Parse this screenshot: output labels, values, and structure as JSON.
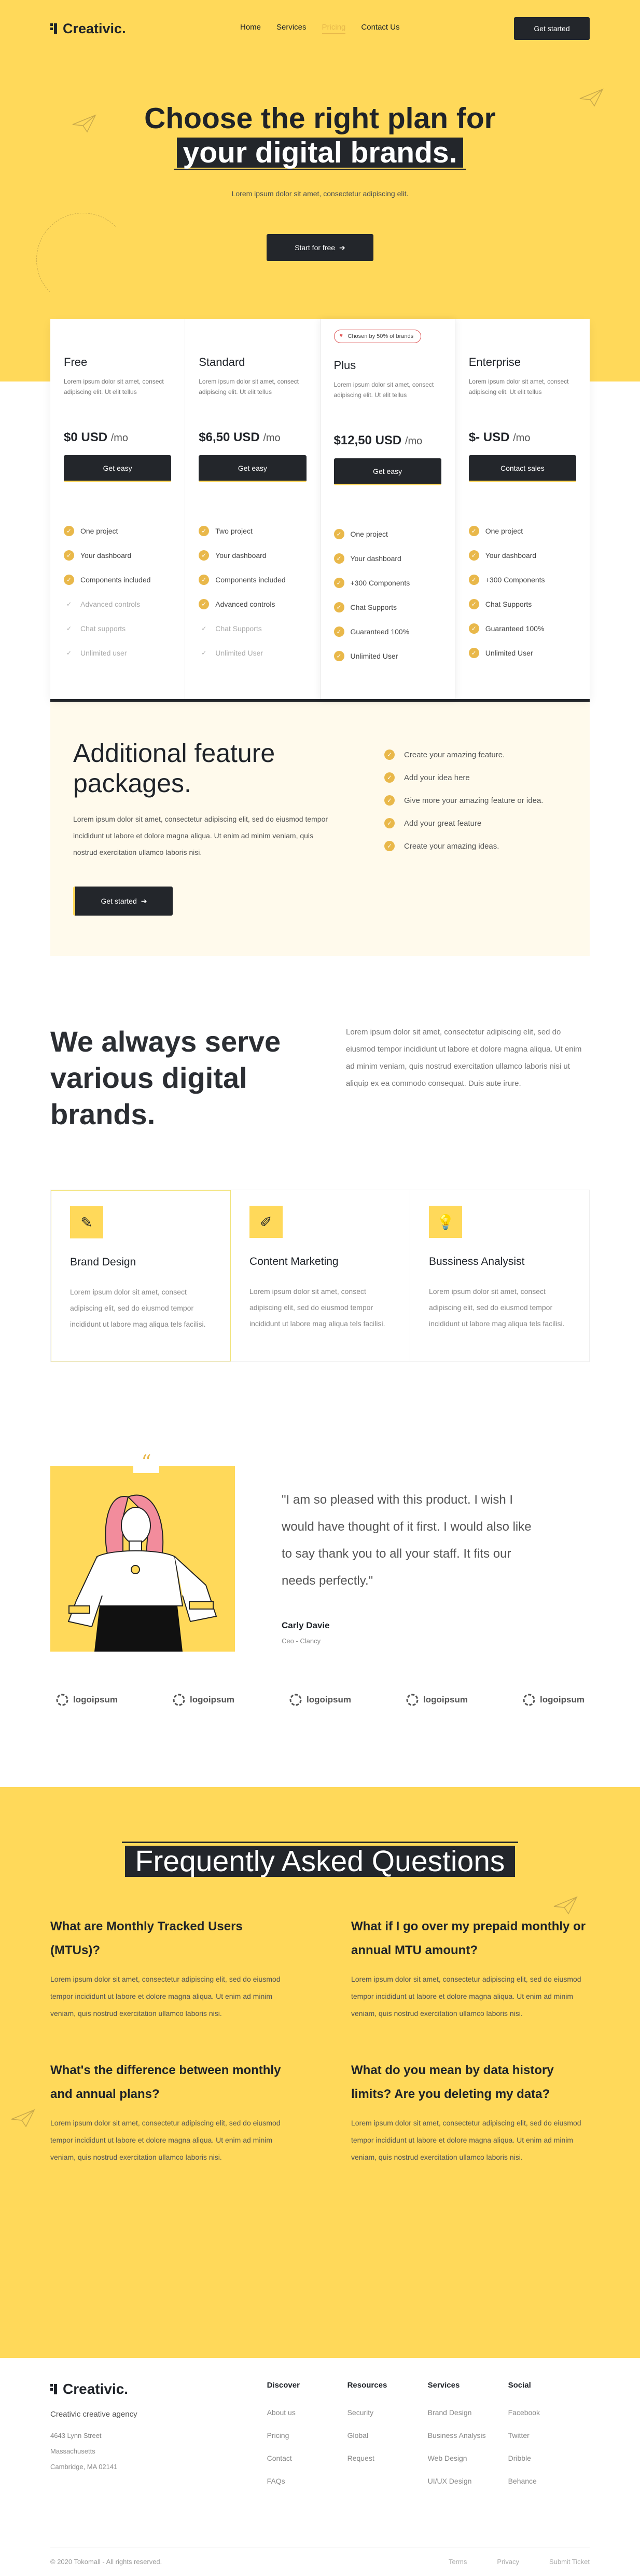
{
  "brand": {
    "name": "Creativic."
  },
  "nav": {
    "items": [
      {
        "label": "Home",
        "active": false
      },
      {
        "label": "Services",
        "active": false
      },
      {
        "label": "Pricing",
        "active": true
      },
      {
        "label": "Contact Us",
        "active": false
      }
    ],
    "cta": "Get started"
  },
  "hero": {
    "title_line1": "Choose the right plan for",
    "title_line2": "your digital brands.",
    "subtitle": "Lorem ipsum dolor sit amet, consectetur adipiscing elit.",
    "cta": "Start for free"
  },
  "plans": [
    {
      "name": "Free",
      "desc": "Lorem ipsum dolor sit amet, consect adipiscing elit. Ut elit tellus",
      "price": "$0 USD",
      "period": "/mo",
      "cta": "Get easy",
      "badge": "",
      "features": [
        {
          "text": "One project",
          "on": true
        },
        {
          "text": "Your dashboard",
          "on": true
        },
        {
          "text": "Components included",
          "on": true
        },
        {
          "text": "Advanced controls",
          "on": false
        },
        {
          "text": "Chat supports",
          "on": false
        },
        {
          "text": "Unlimited user",
          "on": false
        }
      ]
    },
    {
      "name": "Standard",
      "desc": "Lorem ipsum dolor sit amet, consect adipiscing elit. Ut elit tellus",
      "price": "$6,50 USD",
      "period": "/mo",
      "cta": "Get easy",
      "badge": "",
      "features": [
        {
          "text": "Two project",
          "on": true
        },
        {
          "text": "Your dashboard",
          "on": true
        },
        {
          "text": "Components included",
          "on": true
        },
        {
          "text": "Advanced controls",
          "on": true
        },
        {
          "text": "Chat Supports",
          "on": false
        },
        {
          "text": "Unlimited User",
          "on": false
        }
      ]
    },
    {
      "name": "Plus",
      "desc": "Lorem ipsum dolor sit amet, consect adipiscing elit. Ut elit tellus",
      "price": "$12,50 USD",
      "period": "/mo",
      "cta": "Get easy",
      "badge": "Chosen by 50% of brands",
      "features": [
        {
          "text": "One project",
          "on": true
        },
        {
          "text": "Your dashboard",
          "on": true
        },
        {
          "text": "+300 Components",
          "on": true
        },
        {
          "text": "Chat Supports",
          "on": true
        },
        {
          "text": "Guaranteed 100%",
          "on": true
        },
        {
          "text": "Unlimited User",
          "on": true
        }
      ]
    },
    {
      "name": "Enterprise",
      "desc": "Lorem ipsum dolor sit amet, consect adipiscing elit. Ut elit tellus",
      "price": "$- USD",
      "period": "/mo",
      "cta": "Contact sales",
      "badge": "",
      "features": [
        {
          "text": "One project",
          "on": true
        },
        {
          "text": "Your dashboard",
          "on": true
        },
        {
          "text": "+300 Components",
          "on": true
        },
        {
          "text": "Chat Supports",
          "on": true
        },
        {
          "text": "Guaranteed 100%",
          "on": true
        },
        {
          "text": "Unlimited User",
          "on": true
        }
      ]
    }
  ],
  "additional": {
    "title": "Additional feature packages.",
    "text": "Lorem ipsum dolor sit amet, consectetur adipiscing elit, sed do eiusmod tempor incididunt ut labore et dolore magna aliqua. Ut enim ad minim veniam, quis nostrud exercitation ullamco laboris nisi.",
    "cta": "Get started",
    "items": [
      "Create your amazing feature.",
      "Add your idea here",
      "Give more your amazing feature or idea.",
      "Add your great feature",
      "Create your amazing ideas."
    ]
  },
  "serve": {
    "title": "We always serve various digital brands.",
    "text": "Lorem ipsum dolor sit amet, consectetur adipiscing elit, sed do eiusmod tempor incididunt ut labore et dolore magna aliqua. Ut enim ad minim veniam, quis nostrud exercitation ullamco laboris nisi ut aliquip ex ea commodo consequat. Duis aute irure."
  },
  "services": [
    {
      "title": "Brand Design",
      "icon": "pen-tool-icon",
      "glyph": "✎",
      "text": "Lorem ipsum dolor sit amet, consect adipiscing elit, sed do eiusmod tempor incididunt ut labore mag aliqua tels facilisi."
    },
    {
      "title": "Content Marketing",
      "icon": "pencil-ruler-icon",
      "glyph": "✐",
      "text": "Lorem ipsum dolor sit amet, consect adipiscing elit, sed do eiusmod tempor incididunt ut labore mag aliqua tels facilisi."
    },
    {
      "title": "Bussiness Analysist",
      "icon": "lightbulb-icon",
      "glyph": "💡",
      "text": "Lorem ipsum dolor sit amet, consect adipiscing elit, sed do eiusmod tempor incididunt ut labore mag aliqua tels facilisi."
    }
  ],
  "testimonial": {
    "quote": "\"I am so pleased with this product. I wish I would have thought of it first. I would also like to say thank you to all your staff. It fits our needs perfectly.\"",
    "name": "Carly Davie",
    "role": "Ceo - Clancy"
  },
  "logos": [
    "logoipsum",
    "logoipsum",
    "logoipsum",
    "logoipsum",
    "logoipsum"
  ],
  "faq": {
    "title": "Frequently Asked Questions",
    "items": [
      {
        "q": "What are Monthly Tracked Users (MTUs)?",
        "a": "Lorem ipsum dolor sit amet, consectetur adipiscing elit, sed do eiusmod tempor incididunt ut labore et dolore magna aliqua. Ut enim ad minim veniam, quis nostrud exercitation ullamco laboris nisi."
      },
      {
        "q": "What if I go over my prepaid monthly or annual MTU amount?",
        "a": "Lorem ipsum dolor sit amet, consectetur adipiscing elit, sed do eiusmod tempor incididunt ut labore et dolore magna aliqua. Ut enim ad minim veniam, quis nostrud exercitation ullamco laboris nisi."
      },
      {
        "q": "What's the difference between monthly and annual plans?",
        "a": "Lorem ipsum dolor sit amet, consectetur adipiscing elit, sed do eiusmod tempor incididunt ut labore et dolore magna aliqua. Ut enim ad minim veniam, quis nostrud exercitation ullamco laboris nisi."
      },
      {
        "q": "What do you mean by data history limits? Are you deleting my data?",
        "a": "Lorem ipsum dolor sit amet, consectetur adipiscing elit, sed do eiusmod tempor incididunt ut labore et dolore magna aliqua. Ut enim ad minim veniam, quis nostrud exercitation ullamco laboris nisi."
      }
    ]
  },
  "footer": {
    "brand": "Creativic.",
    "tagline": "Creativic creative agency",
    "address": [
      "4643 Lynn Street",
      "Massachusetts",
      "Cambridge, MA 02141"
    ],
    "columns": [
      {
        "title": "Discover",
        "links": [
          "About us",
          "Pricing",
          "Contact",
          "FAQs"
        ]
      },
      {
        "title": "Resources",
        "links": [
          "Security",
          "Global",
          "Request"
        ]
      },
      {
        "title": "Services",
        "links": [
          "Brand Design",
          "Business Analysis",
          "Web Design",
          "UI/UX Design"
        ]
      },
      {
        "title": "Social",
        "links": [
          "Facebook",
          "Twitter",
          "Dribble",
          "Behance"
        ]
      }
    ],
    "copyright": "© 2020 Tokomall - All rights reserved.",
    "legal": [
      "Terms",
      "Privacy",
      "Submit Ticket"
    ]
  },
  "colors": {
    "accent": "#ffd95a",
    "dark": "#23262b",
    "check": "#e9b84a"
  }
}
